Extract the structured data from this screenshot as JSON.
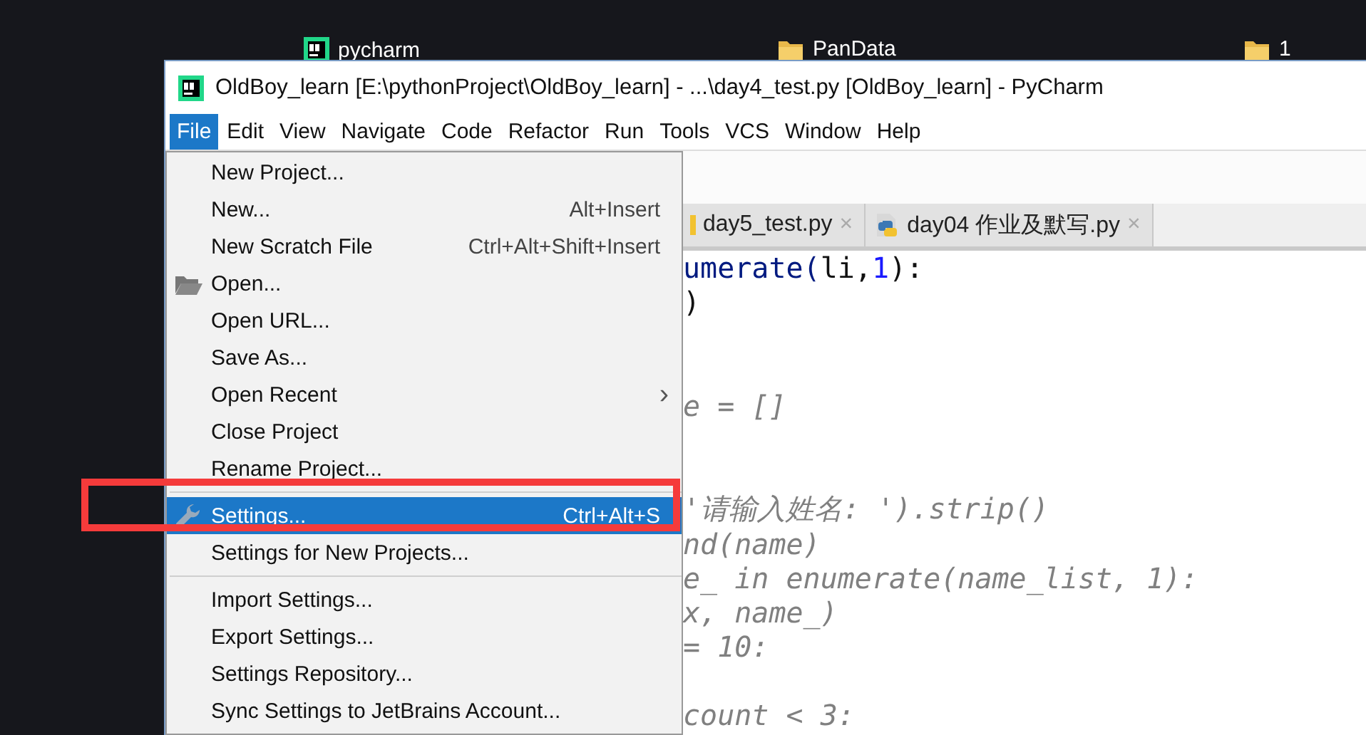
{
  "desktop": {
    "icons": [
      {
        "label": "pycharm",
        "kind": "app"
      },
      {
        "label": "PanData",
        "kind": "folder"
      },
      {
        "label": "1",
        "kind": "folder"
      }
    ]
  },
  "window": {
    "title": "OldBoy_learn [E:\\pythonProject\\OldBoy_learn] - ...\\day4_test.py [OldBoy_learn] - PyCharm"
  },
  "menu_bar": [
    {
      "label": "File",
      "selected": true
    },
    {
      "label": "Edit",
      "selected": false
    },
    {
      "label": "View",
      "selected": false
    },
    {
      "label": "Navigate",
      "selected": false
    },
    {
      "label": "Code",
      "selected": false
    },
    {
      "label": "Refactor",
      "selected": false
    },
    {
      "label": "Run",
      "selected": false
    },
    {
      "label": "Tools",
      "selected": false
    },
    {
      "label": "VCS",
      "selected": false
    },
    {
      "label": "Window",
      "selected": false
    },
    {
      "label": "Help",
      "selected": false
    }
  ],
  "file_menu": [
    {
      "kind": "item",
      "label": "New Project...",
      "selected": false
    },
    {
      "kind": "item",
      "label": "New...",
      "shortcut": "Alt+Insert",
      "selected": false
    },
    {
      "kind": "item",
      "label": "New Scratch File",
      "shortcut": "Ctrl+Alt+Shift+Insert",
      "selected": false
    },
    {
      "kind": "folder",
      "label": "Open...",
      "selected": false
    },
    {
      "kind": "item",
      "label": "Open URL...",
      "selected": false
    },
    {
      "kind": "item",
      "label": "Save As...",
      "selected": false
    },
    {
      "kind": "item",
      "label": "Open Recent",
      "submenu": "›",
      "selected": false
    },
    {
      "kind": "item",
      "label": "Close Project",
      "selected": false
    },
    {
      "kind": "item",
      "label": "Rename Project...",
      "selected": false
    },
    {
      "kind": "separator"
    },
    {
      "kind": "wrench",
      "label": "Settings...",
      "shortcut": "Ctrl+Alt+S",
      "selected": true
    },
    {
      "kind": "item",
      "label": "Settings for New Projects...",
      "selected": false
    },
    {
      "kind": "separator"
    },
    {
      "kind": "item",
      "label": "Import Settings...",
      "selected": false
    },
    {
      "kind": "item",
      "label": "Export Settings...",
      "selected": false
    },
    {
      "kind": "item",
      "label": "Settings Repository...",
      "selected": false
    },
    {
      "kind": "item",
      "label": "Sync Settings to JetBrains Account...",
      "selected": false
    },
    {
      "kind": "separator"
    }
  ],
  "editor_tabs": [
    {
      "label": "day5_test.py",
      "close": "×",
      "selected": false
    },
    {
      "label": "day04 作业及默写.py",
      "close": "×",
      "selected": false
    }
  ],
  "code_lines": [
    {
      "kind": "code",
      "tokens": [
        {
          "text": "umerate(",
          "kind": "call"
        },
        {
          "text": "li,",
          "kind": "plain"
        },
        {
          "text": "1",
          "kind": "number"
        },
        {
          "text": "):",
          "kind": "plain"
        }
      ]
    },
    {
      "kind": "code",
      "tokens": [
        {
          "text": ")",
          "kind": "plain"
        }
      ]
    },
    {
      "kind": "blank"
    },
    {
      "kind": "blank"
    },
    {
      "kind": "code",
      "tokens": [
        {
          "text": "e = []",
          "kind": "comment"
        }
      ]
    },
    {
      "kind": "blank"
    },
    {
      "kind": "blank"
    },
    {
      "kind": "code",
      "tokens": [
        {
          "text": "'请输入姓名: ').strip()",
          "kind": "comment"
        }
      ]
    },
    {
      "kind": "code",
      "tokens": [
        {
          "text": "nd(name)",
          "kind": "comment"
        }
      ]
    },
    {
      "kind": "code",
      "tokens": [
        {
          "text": "e_ in enumerate(name_list, 1):",
          "kind": "comment"
        }
      ]
    },
    {
      "kind": "code",
      "tokens": [
        {
          "text": "x, name_)",
          "kind": "comment"
        }
      ]
    },
    {
      "kind": "code",
      "tokens": [
        {
          "text": "= 10:",
          "kind": "comment"
        }
      ]
    },
    {
      "kind": "blank"
    },
    {
      "kind": "code",
      "tokens": [
        {
          "text": "count < 3:",
          "kind": "comment"
        }
      ]
    }
  ]
}
